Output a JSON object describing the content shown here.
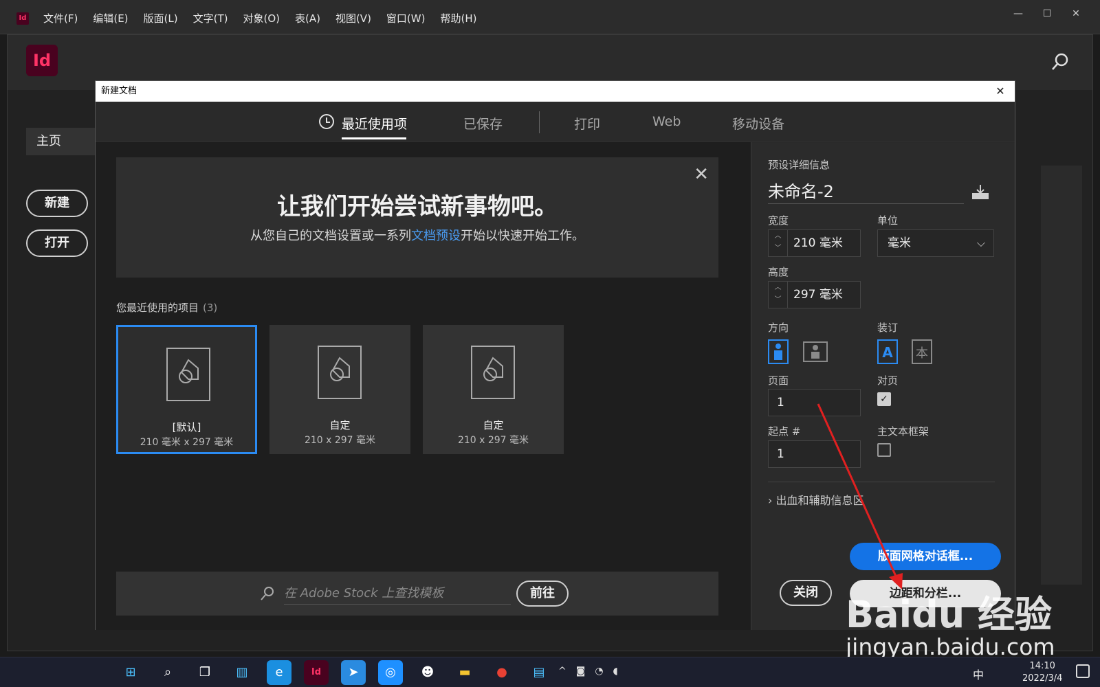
{
  "menubar": {
    "app_icon": "Id",
    "menus": [
      "文件(F)",
      "编辑(E)",
      "版面(L)",
      "文字(T)",
      "对象(O)",
      "表(A)",
      "视图(V)",
      "窗口(W)",
      "帮助(H)"
    ],
    "window_controls": [
      "minimize-icon",
      "maximize-icon",
      "close-icon"
    ]
  },
  "app": {
    "logo": "Id",
    "home_tab": "主页",
    "new_button": "新建",
    "open_button": "打开"
  },
  "dialog": {
    "title": "新建文档",
    "close": "✕",
    "tabs": [
      {
        "label": "最近使用项",
        "active": true
      },
      {
        "label": "已保存",
        "active": false
      },
      {
        "label": "打印",
        "active": false
      },
      {
        "label": "Web",
        "active": false
      },
      {
        "label": "移动设备",
        "active": false
      }
    ],
    "promo": {
      "heading": "让我们开始尝试新事物吧。",
      "text_before": "从您自己的文档设置或一系列",
      "link": "文档预设",
      "text_after": "开始以快速开始工作。"
    },
    "recent": {
      "title": "您最近使用的项目",
      "count": "(3)",
      "items": [
        {
          "name": "[默认]",
          "size": "210 毫米 x 297 毫米",
          "selected": true
        },
        {
          "name": "自定",
          "size": "210 x 297 毫米",
          "selected": false
        },
        {
          "name": "自定",
          "size": "210 x 297 毫米",
          "selected": false
        }
      ]
    },
    "stock": {
      "placeholder": "在 Adobe Stock 上查找模板",
      "go_button": "前往"
    },
    "preset": {
      "section_title": "预设详细信息",
      "doc_name": "未命名-2",
      "width_label": "宽度",
      "width_value": "210 毫米",
      "unit_label": "单位",
      "unit_value": "毫米",
      "height_label": "高度",
      "height_value": "297 毫米",
      "orientation_label": "方向",
      "binding_label": "装订",
      "pages_label": "页面",
      "pages_value": "1",
      "facing_label": "对页",
      "facing_checked": true,
      "start_label": "起点 #",
      "start_value": "1",
      "primary_frame_label": "主文本框架",
      "primary_frame_checked": false,
      "bleed_label": "出血和辅助信息区"
    },
    "buttons": {
      "layout_grid": "版面网格对话框...",
      "close": "关闭",
      "margins": "边距和分栏..."
    }
  },
  "watermark": {
    "logo": "Baidu 经验",
    "url": "jingyan.baidu.com"
  },
  "taskbar": {
    "ime": "中",
    "time": "14:10",
    "date": "2022/3/4"
  },
  "colors": {
    "accent": "#1473e6",
    "selection": "#2b8bf2",
    "indesign_pink": "#ff3366",
    "annotation_arrow": "#e02020"
  }
}
